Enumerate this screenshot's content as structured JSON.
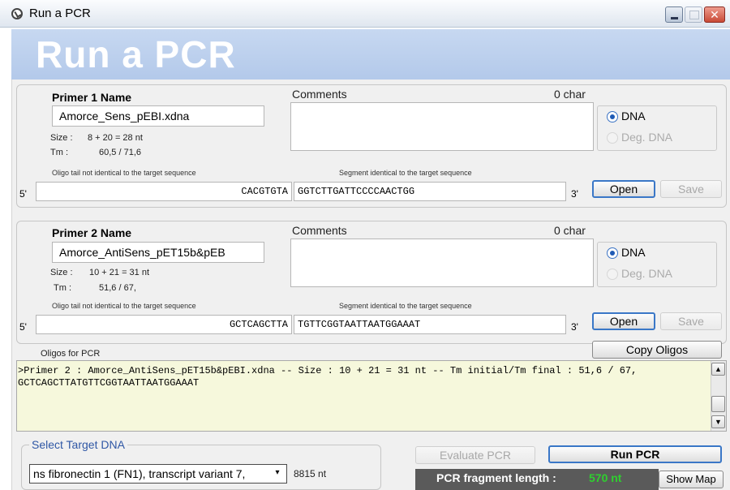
{
  "window": {
    "title": "Run a PCR",
    "banner_title": "Run a PCR",
    "close_glyph": "✕"
  },
  "primer1": {
    "name_label": "Primer 1 Name",
    "name_value": "Amorce_Sens_pEBI.xdna",
    "size_label": "Size :",
    "size_value": "8 + 20 = 28 nt",
    "tm_label": "Tm :",
    "tm_value": "60,5 / 71,6",
    "comments_label": "Comments",
    "char_count": "0 char",
    "dna_option": "DNA",
    "deg_dna_option": "Deg. DNA",
    "selected_type": "DNA",
    "tail_caption": "Oligo tail not identical to the target sequence",
    "segment_caption": "Segment identical to the target sequence",
    "five_prime": "5'",
    "three_prime": "3'",
    "tail_sequence": "CACGTGTA",
    "segment_sequence": "GGTCTTGATTCCCCAACTGG",
    "open_label": "Open",
    "save_label": "Save"
  },
  "primer2": {
    "name_label": "Primer 2 Name",
    "name_value": "Amorce_AntiSens_pET15b&pEB",
    "size_label": "Size :",
    "size_value": "10 + 21 = 31 nt",
    "tm_label": "Tm :",
    "tm_value": "51,6 / 67,",
    "comments_label": "Comments",
    "char_count": "0 char",
    "dna_option": "DNA",
    "deg_dna_option": "Deg. DNA",
    "selected_type": "DNA",
    "tail_caption": "Oligo tail not identical to the target sequence",
    "segment_caption": "Segment identical to the target sequence",
    "five_prime": "5'",
    "three_prime": "3'",
    "tail_sequence": "GCTCAGCTTA",
    "segment_sequence": "TGTTCGGTAATTAATGGAAAT",
    "open_label": "Open",
    "save_label": "Save"
  },
  "oligos": {
    "label": "Oligos for PCR",
    "copy_label": "Copy Oligos",
    "text": ">Primer 2 : Amorce_AntiSens_pET15b&pEBI.xdna -- Size : 10 + 21 = 31 nt -- Tm initial/Tm final : 51,6 / 67,\nGCTCAGCTTATGTTCGGTAATTAATGGAAAT"
  },
  "target": {
    "legend": "Select Target DNA",
    "selected": "ns fibronectin 1 (FN1), transcript variant 7,",
    "size": "8815 nt"
  },
  "actions": {
    "evaluate_label": "Evaluate PCR",
    "run_label": "Run PCR",
    "fragment_label": "PCR fragment length :",
    "fragment_value": "570 nt",
    "show_map_label": "Show Map"
  },
  "colors": {
    "banner": "#b9cdea",
    "fragment_value": "#2fcf2f",
    "oligo_box": "#f6f8dc",
    "target_legend": "#2f57a5"
  },
  "icons": {
    "app": "clock-icon",
    "scroll_up": "▲",
    "scroll_down": "▼",
    "dropdown": "▾"
  }
}
